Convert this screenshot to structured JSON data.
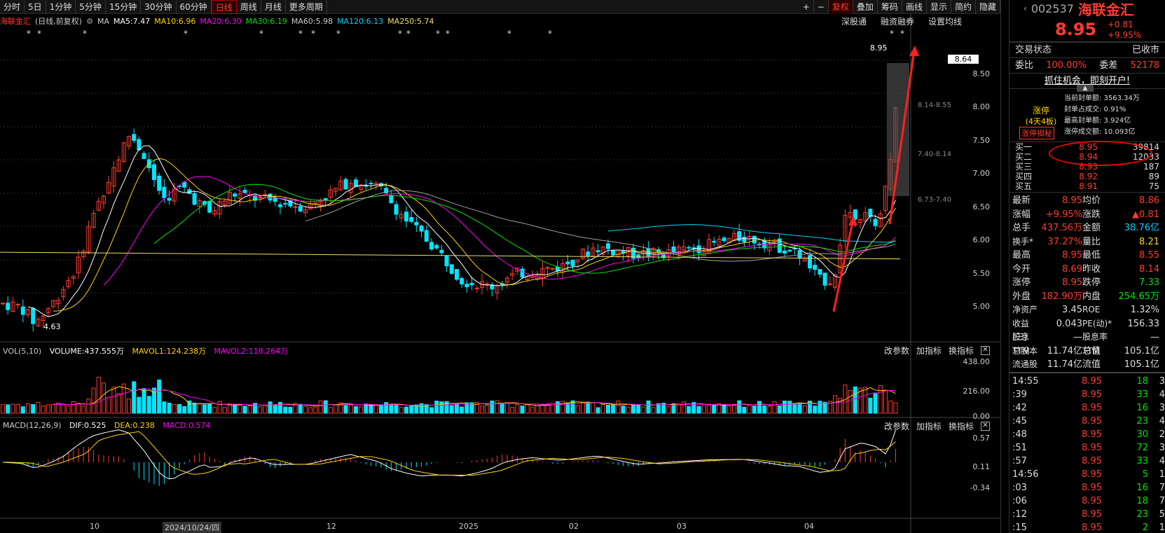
{
  "toolbar": {
    "items": [
      "分时",
      "5日",
      "1分钟",
      "5分钟",
      "15分钟",
      "30分钟",
      "60分钟",
      "日线",
      "周线",
      "月线",
      "更多周期"
    ],
    "active": "日线",
    "right": [
      "+",
      "−",
      "复权",
      "叠加",
      "筹码",
      "画线",
      "显示",
      "简约",
      "隐藏"
    ]
  },
  "info": {
    "name": "海联金汇",
    "period": "(日线,前复权)",
    "ma_label": "MA",
    "ma5": "MA5:7.47",
    "ma10": "MA10:6.96",
    "ma20": "MA20:6.30",
    "ma30": "MA30:6.19",
    "ma60": "MA60:5.98",
    "ma120": "MA120:6.13",
    "ma250": "MA250:5.74"
  },
  "chart_links": [
    "深股通",
    "融资融券",
    "设置均线"
  ],
  "colors": {
    "ma5": "#ffffff",
    "ma10": "#ffd400",
    "ma20": "#ff00ff",
    "ma30": "#00e600",
    "ma60": "#a0a0a0",
    "ma120": "#00d0ff",
    "ma250": "#f0e060",
    "up": "#ff3b30",
    "down": "#00e5ff"
  },
  "price_axis": {
    "ticks": [
      "8.50",
      "8.00",
      "7.50",
      "7.00",
      "6.50",
      "6.00",
      "5.50",
      "5.00"
    ],
    "current": "8.64",
    "high_label": "8.95",
    "low_label": "4.63",
    "range_labels": [
      "8.14-8.55",
      "7.40-8.14",
      "6.73-7.40"
    ]
  },
  "volume": {
    "label": "VOL(5,10)",
    "volume": "VOLUME:437.555万",
    "mavol1": "MAVOL1:124.238万",
    "mavol2": "MAVOL2:118.264万",
    "ticks": [
      "438.00",
      "216.00",
      "0.00"
    ],
    "buttons": [
      "改参数",
      "加指标",
      "换指标"
    ]
  },
  "macd": {
    "label": "MACD(12,26,9)",
    "dif": "DIF:0.525",
    "dea": "DEA:0.238",
    "macd": "MACD:0.574",
    "ticks": [
      "0.57",
      "0.11",
      "-0.34"
    ],
    "buttons": [
      "改参数",
      "加指标",
      "换指标"
    ]
  },
  "xaxis": {
    "labels": [
      "10",
      "2024/10/24/四",
      "12",
      "2025",
      "02",
      "03",
      "04"
    ]
  },
  "side": {
    "code": "002537",
    "name": "海联金汇",
    "price": "8.95",
    "change": "+0.81",
    "pct": "+9.95%",
    "status_label": "交易状态",
    "status": "已收市",
    "weibi_label": "委比",
    "weibi": "100.00%",
    "weicha_label": "委差",
    "weicha": "52178",
    "promo": "抓住机会，即刻开户!",
    "zt": {
      "title": "涨停",
      "sub": "(4天4板)",
      "btn": "涨停揭秘",
      "lines": [
        "当前封单额: 3563.34万",
        "封单占成交: 0.91%",
        "最高封单额: 3.924亿",
        "涨停成交额: 10.093亿"
      ]
    },
    "bids": [
      {
        "l": "买一",
        "p": "8.95",
        "v": "39814"
      },
      {
        "l": "买二",
        "p": "8.94",
        "v": "12033"
      },
      {
        "l": "买三",
        "p": "8.93",
        "v": "187"
      },
      {
        "l": "买四",
        "p": "8.92",
        "v": "89"
      },
      {
        "l": "买五",
        "p": "8.91",
        "v": "75"
      }
    ],
    "stats": [
      [
        "最新",
        "8.95",
        "均价",
        "8.86"
      ],
      [
        "涨幅",
        "+9.95%",
        "涨跌",
        "▲0.81"
      ],
      [
        "总手",
        "437.56万",
        "金额",
        "38.76亿"
      ],
      [
        "换手*",
        "37.27%",
        "量比",
        "8.21"
      ],
      [
        "最高",
        "8.95",
        "最低",
        "8.55"
      ],
      [
        "今开",
        "8.69",
        "昨收",
        "8.14"
      ],
      [
        "涨停",
        "8.95",
        "跌停",
        "7.33"
      ],
      [
        "外盘",
        "182.90万",
        "内盘",
        "254.65万"
      ],
      [
        "净资产",
        "3.45",
        "ROE",
        "1.32%"
      ],
      [
        "收益(三)",
        "0.043",
        "PE(动)*",
        "156.33"
      ],
      [
        "股息TTM",
        "—",
        "股息率TTM",
        "—"
      ],
      [
        "总股本",
        "11.74亿",
        "总值",
        "105.1亿"
      ],
      [
        "流通股",
        "11.74亿",
        "流值",
        "105.1亿"
      ]
    ],
    "ticks": [
      [
        "14:55",
        "8.95",
        "18",
        "3"
      ],
      [
        ":39",
        "8.95",
        "33",
        "4"
      ],
      [
        ":42",
        "8.95",
        "16",
        "3"
      ],
      [
        ":45",
        "8.95",
        "23",
        "4"
      ],
      [
        ":48",
        "8.95",
        "30",
        "2"
      ],
      [
        ":51",
        "8.95",
        "72",
        "3"
      ],
      [
        ":57",
        "8.95",
        "33",
        "4"
      ],
      [
        "14:56",
        "8.95",
        "5",
        "1"
      ],
      [
        ":03",
        "8.95",
        "16",
        "7"
      ],
      [
        ":06",
        "8.95",
        "18",
        "7"
      ],
      [
        ":12",
        "8.95",
        "23",
        "5"
      ],
      [
        ":15",
        "8.95",
        "2",
        "1"
      ]
    ]
  }
}
